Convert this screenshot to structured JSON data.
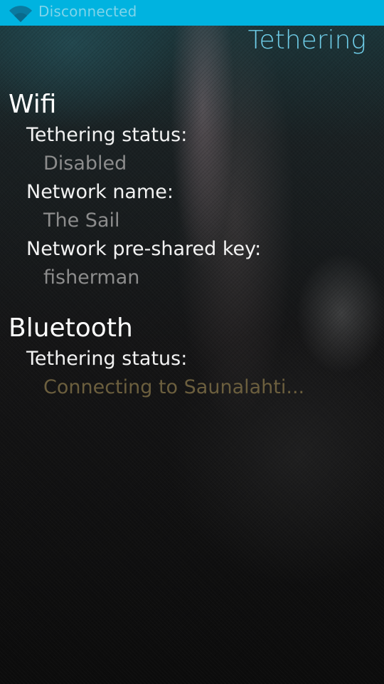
{
  "status_bar": {
    "icon": "wifi-icon",
    "text": "Disconnected",
    "color": "#00b3e0"
  },
  "page": {
    "title": "Tethering"
  },
  "wifi": {
    "heading": "Wifi",
    "status_label": "Tethering status:",
    "status_value": "Disabled",
    "name_label": "Network name:",
    "name_value": "The Sail",
    "key_label": "Network pre-shared key:",
    "key_value": "fisherman"
  },
  "bluetooth": {
    "heading": "Bluetooth",
    "status_label": "Tethering status:",
    "status_value": "Connecting to Saunalahti..."
  }
}
